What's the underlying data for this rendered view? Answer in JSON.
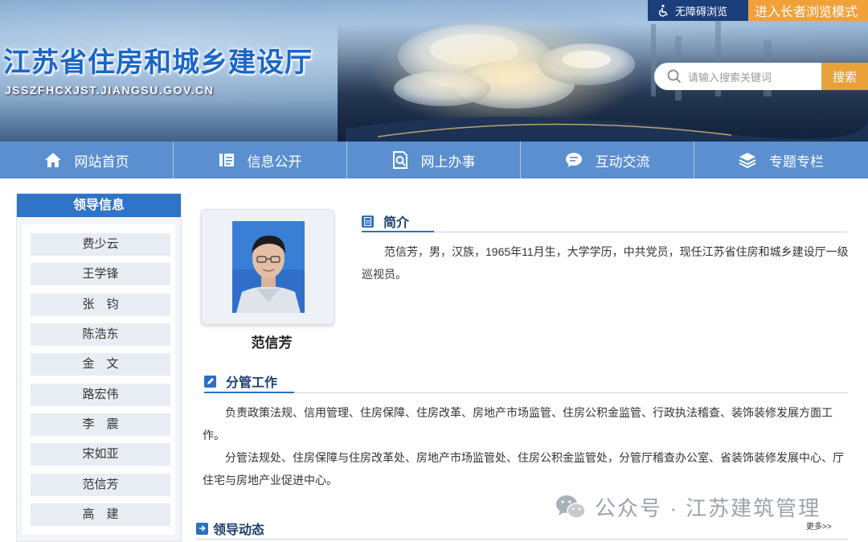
{
  "header": {
    "site_title": "江苏省住房和城乡建设厅",
    "site_url": "JSSZFHCXJST.JIANGSU.GOV.CN",
    "accessibility_label": "无障碍浏览",
    "elder_mode_label": "进入长者浏览模式",
    "search_placeholder": "请输入搜索关键词",
    "search_button": "搜索"
  },
  "nav": {
    "items": [
      {
        "label": "网站首页",
        "icon": "home-icon"
      },
      {
        "label": "信息公开",
        "icon": "document-list-icon"
      },
      {
        "label": "网上办事",
        "icon": "search-doc-icon"
      },
      {
        "label": "互动交流",
        "icon": "chat-icon"
      },
      {
        "label": "专题专栏",
        "icon": "layers-icon"
      }
    ]
  },
  "sidebar": {
    "title": "领导信息",
    "leaders": [
      "费少云",
      "王学锋",
      "张　钧",
      "陈浩东",
      "金　文",
      "路宏伟",
      "李　震",
      "宋如亚",
      "范信芳",
      "高　建"
    ]
  },
  "profile": {
    "name": "范信芳",
    "intro_title": "简介",
    "intro_text": "范信芳，男，汉族，1965年11月生，大学学历，中共党员，现任江苏省住房和城乡建设厅一级巡视员。",
    "duties_title": "分管工作",
    "duties_text_1": "负责政策法规、信用管理、住房保障、住房改革、房地产市场监管、住房公积金监管、行政执法稽查、装饰装修发展方面工作。",
    "duties_text_2": "分管法规处、住房保障与住房改革处、房地产市场监管处、住房公积金监管处，分管厅稽查办公室、省装饰装修发展中心、厅住宅与房地产业促进中心。",
    "news_title": "领导动态",
    "more_label": "更多>>"
  },
  "watermark": {
    "text": "公众号 · 江苏建筑管理"
  },
  "colors": {
    "nav_bg": "#5b8fd0",
    "sidebar_head": "#2f74c6",
    "accent_orange": "#f0a13a",
    "title_blue": "#1a66c8"
  }
}
